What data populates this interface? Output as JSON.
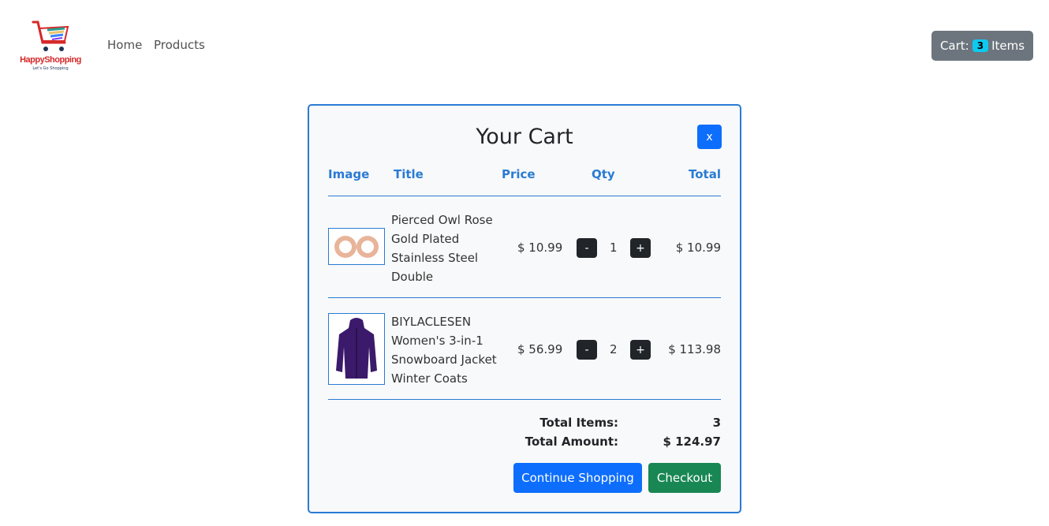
{
  "nav": {
    "logo_text": "HappyShopping",
    "logo_tagline": "Let's Go Shopping",
    "links": [
      "Home",
      "Products"
    ],
    "cart_prefix": "Cart:",
    "cart_count": "3",
    "cart_suffix": "Items"
  },
  "cart": {
    "title": "Your Cart",
    "close_label": "x",
    "columns": [
      "Image",
      "Title",
      "Price",
      "Qty",
      "Total"
    ],
    "items": [
      {
        "title": "Pierced Owl Rose Gold Plated Stainless Steel Double",
        "price": "$ 10.99",
        "qty": "1",
        "total": "$ 10.99",
        "image_icon": "rose-gold-ear-plugs-image"
      },
      {
        "title": "BIYLACLESEN Women's 3-in-1 Snowboard Jacket Winter Coats",
        "price": "$ 56.99",
        "qty": "2",
        "total": "$ 113.98",
        "image_icon": "purple-jacket-image"
      }
    ],
    "minus_label": "-",
    "plus_label": "+",
    "total_items_label": "Total Items:",
    "total_items_value": "3",
    "total_amount_label": "Total Amount:",
    "total_amount_value": "$ 124.97",
    "continue_label": "Continue Shopping",
    "checkout_label": "Checkout"
  },
  "colors": {
    "accent": "#2a7bd4",
    "primary": "#0d6efd",
    "success": "#198754",
    "secondary": "#6c757d",
    "badge": "#0dcaf0"
  }
}
